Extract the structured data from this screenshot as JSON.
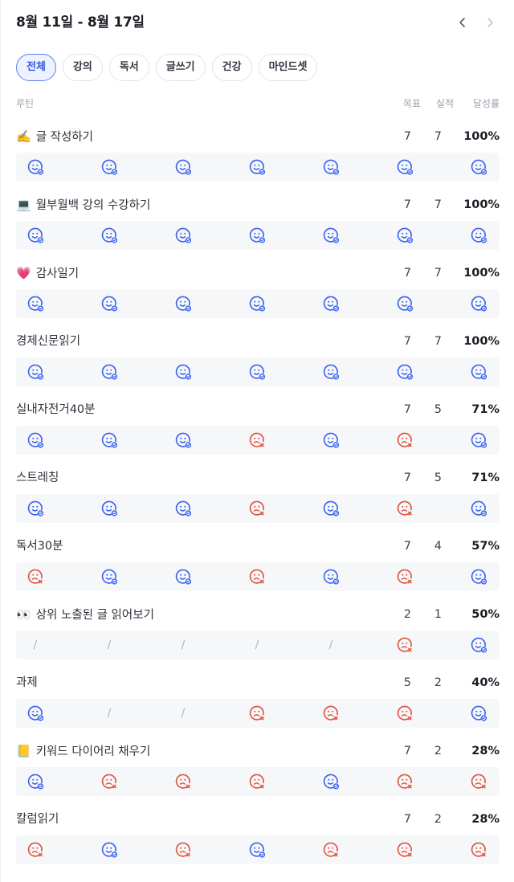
{
  "header": {
    "date_range": "8월 11일 - 8월 17일"
  },
  "tabs": [
    {
      "label": "전체",
      "active": true
    },
    {
      "label": "강의",
      "active": false
    },
    {
      "label": "독서",
      "active": false
    },
    {
      "label": "글쓰기",
      "active": false
    },
    {
      "label": "건강",
      "active": false
    },
    {
      "label": "마인드셋",
      "active": false
    }
  ],
  "columns": {
    "routine": "루틴",
    "goal": "목표",
    "actual": "실적",
    "rate": "달성률"
  },
  "icons": {
    "done": "smile-check-icon",
    "missed": "frown-x-icon",
    "none": "/"
  },
  "colors": {
    "done": "#3b63f0",
    "missed": "#e0533f",
    "accent": "#5b7cf0"
  },
  "routines": [
    {
      "emoji": "✍️",
      "name": "글 작성하기",
      "goal": "7",
      "actual": "7",
      "rate": "100%",
      "days": [
        "done",
        "done",
        "done",
        "done",
        "done",
        "done",
        "done"
      ]
    },
    {
      "emoji": "💻",
      "name": "월부월백 강의 수강하기",
      "goal": "7",
      "actual": "7",
      "rate": "100%",
      "days": [
        "done",
        "done",
        "done",
        "done",
        "done",
        "done",
        "done"
      ]
    },
    {
      "emoji": "💗",
      "name": "감사일기",
      "goal": "7",
      "actual": "7",
      "rate": "100%",
      "days": [
        "done",
        "done",
        "done",
        "done",
        "done",
        "done",
        "done"
      ]
    },
    {
      "emoji": "",
      "name": "경제신문읽기",
      "goal": "7",
      "actual": "7",
      "rate": "100%",
      "days": [
        "done",
        "done",
        "done",
        "done",
        "done",
        "done",
        "done"
      ]
    },
    {
      "emoji": "",
      "name": "실내자전거40분",
      "goal": "7",
      "actual": "5",
      "rate": "71%",
      "days": [
        "done",
        "done",
        "done",
        "missed",
        "done",
        "missed",
        "done"
      ]
    },
    {
      "emoji": "",
      "name": "스트레칭",
      "goal": "7",
      "actual": "5",
      "rate": "71%",
      "days": [
        "done",
        "done",
        "done",
        "missed",
        "done",
        "missed",
        "done"
      ]
    },
    {
      "emoji": "",
      "name": "독서30분",
      "goal": "7",
      "actual": "4",
      "rate": "57%",
      "days": [
        "missed",
        "done",
        "done",
        "missed",
        "done",
        "missed",
        "done"
      ]
    },
    {
      "emoji": "👀",
      "name": "상위 노출된 글 읽어보기",
      "goal": "2",
      "actual": "1",
      "rate": "50%",
      "days": [
        "none",
        "none",
        "none",
        "none",
        "none",
        "missed",
        "done"
      ]
    },
    {
      "emoji": "",
      "name": "과제",
      "goal": "5",
      "actual": "2",
      "rate": "40%",
      "days": [
        "done",
        "none",
        "none",
        "missed",
        "missed",
        "missed",
        "done"
      ]
    },
    {
      "emoji": "📒",
      "name": "키워드 다이어리 채우기",
      "goal": "7",
      "actual": "2",
      "rate": "28%",
      "days": [
        "done",
        "missed",
        "missed",
        "missed",
        "done",
        "missed",
        "missed"
      ]
    },
    {
      "emoji": "",
      "name": "칼럼읽기",
      "goal": "7",
      "actual": "2",
      "rate": "28%",
      "days": [
        "missed",
        "done",
        "missed",
        "done",
        "missed",
        "missed",
        "missed"
      ]
    }
  ]
}
